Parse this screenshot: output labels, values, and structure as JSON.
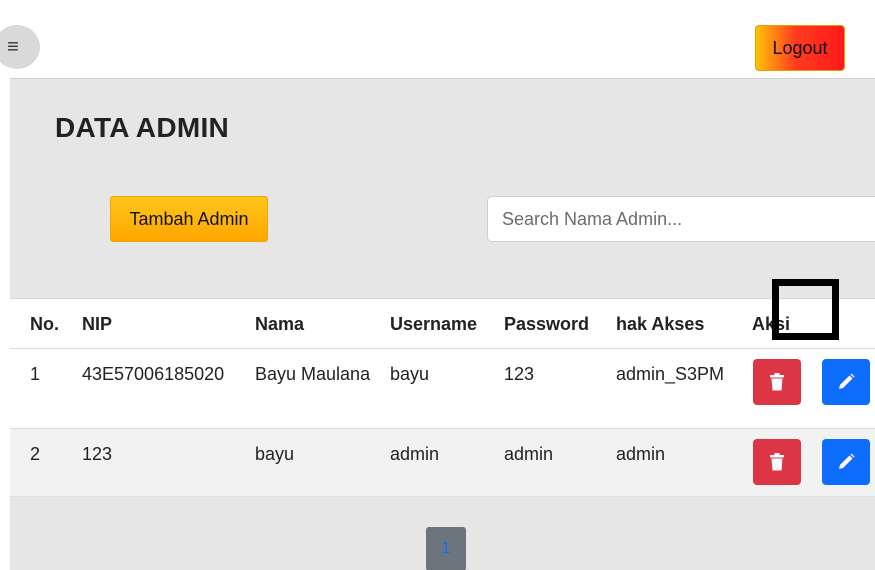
{
  "topbar": {
    "menu_icon": "hamburger-icon",
    "menu_glyph": "≡",
    "logout_label": "Logout"
  },
  "main": {
    "title": "DATA ADMIN",
    "add_button_label": "Tambah Admin",
    "search": {
      "placeholder": "Search Nama Admin...",
      "value": ""
    }
  },
  "table": {
    "columns": [
      "No.",
      "NIP",
      "Nama",
      "Username",
      "Password",
      "hak Akses",
      "Aksi"
    ],
    "rows": [
      {
        "no": "1",
        "nip": "43E57006185020",
        "nama": "Bayu Maulana",
        "username": "bayu",
        "password": "123",
        "hak_akses": "admin_S3PM"
      },
      {
        "no": "2",
        "nip": "123",
        "nama": "bayu",
        "username": "admin",
        "password": "admin",
        "hak_akses": "admin"
      }
    ],
    "actions": {
      "delete_icon": "trash-icon",
      "edit_icon": "pencil-icon"
    }
  },
  "pagination": {
    "current_page": "1"
  },
  "colors": {
    "delete": "#dc3545",
    "edit": "#0d6efd",
    "add_button": "#ffb300",
    "panel_bg": "#e6e6e6"
  }
}
